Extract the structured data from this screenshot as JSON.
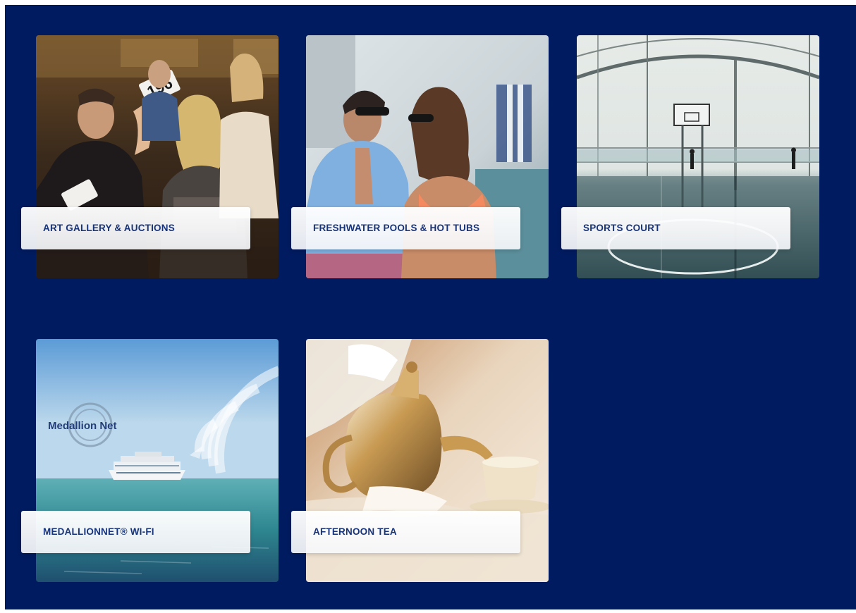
{
  "colors": {
    "background": "#001b60",
    "label_text": "#17337a",
    "label_background": "#ffffff"
  },
  "amenities": [
    {
      "title": "ART GALLERY & AUCTIONS",
      "image": "art-auction-photo",
      "auction_paddle": "196"
    },
    {
      "title": "FRESHWATER POOLS & HOT TUBS",
      "image": "pool-couple-photo"
    },
    {
      "title": "SPORTS COURT",
      "image": "sports-court-photo"
    },
    {
      "title": "MEDALLIONNET® WI-FI",
      "image": "cruise-ship-wifi-photo",
      "logo_text": "Medallion Net"
    },
    {
      "title": "AFTERNOON TEA",
      "image": "teapot-pouring-photo"
    }
  ]
}
